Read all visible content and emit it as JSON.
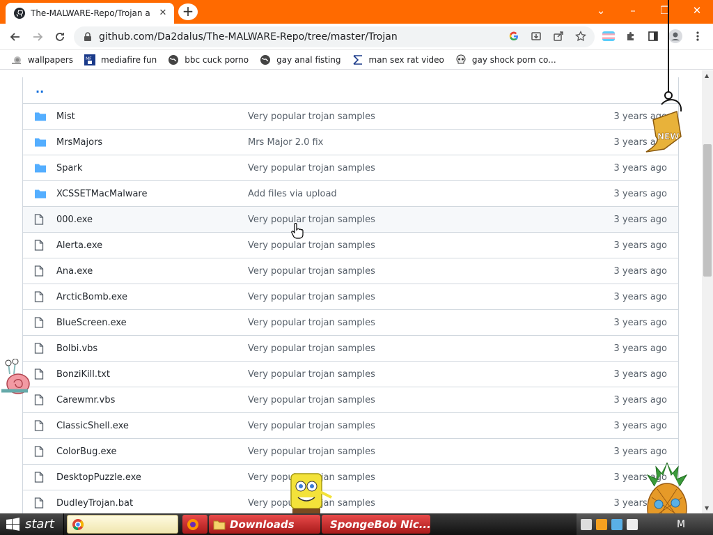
{
  "browser": {
    "tab_title": "The-MALWARE-Repo/Trojan a",
    "new_tab_symbol": "+",
    "url": "github.com/Da2dalus/The-MALWARE-Repo/tree/master/Trojan",
    "accent": "#ff6a00"
  },
  "bookmarks": [
    {
      "label": "wallpapers",
      "icon": "snail-icon"
    },
    {
      "label": "mediafire fun",
      "icon": "mediafire-icon"
    },
    {
      "label": "bbc cuck porno",
      "icon": "globe-icon"
    },
    {
      "label": "gay anal fisting",
      "icon": "globe-icon"
    },
    {
      "label": "man sex rat video",
      "icon": "sigma-icon"
    },
    {
      "label": "gay shock porn co...",
      "icon": "skull-icon"
    }
  ],
  "repo": {
    "parent_dir": "..",
    "files": [
      {
        "name": "Mist",
        "type": "folder",
        "message": "Very popular trojan samples",
        "age": "3 years ago"
      },
      {
        "name": "MrsMajors",
        "type": "folder",
        "message": "Mrs Major 2.0 fix",
        "age": "3 years ago"
      },
      {
        "name": "Spark",
        "type": "folder",
        "message": "Very popular trojan samples",
        "age": "3 years ago"
      },
      {
        "name": "XCSSETMacMalware",
        "type": "folder",
        "message": "Add files via upload",
        "age": "3 years ago"
      },
      {
        "name": "000.exe",
        "type": "file",
        "message": "Very popular trojan samples",
        "age": "3 years ago"
      },
      {
        "name": "Alerta.exe",
        "type": "file",
        "message": "Very popular trojan samples",
        "age": "3 years ago"
      },
      {
        "name": "Ana.exe",
        "type": "file",
        "message": "Very popular trojan samples",
        "age": "3 years ago"
      },
      {
        "name": "ArcticBomb.exe",
        "type": "file",
        "message": "Very popular trojan samples",
        "age": "3 years ago"
      },
      {
        "name": "BlueScreen.exe",
        "type": "file",
        "message": "Very popular trojan samples",
        "age": "3 years ago"
      },
      {
        "name": "Bolbi.vbs",
        "type": "file",
        "message": "Very popular trojan samples",
        "age": "3 years ago"
      },
      {
        "name": "BonziKill.txt",
        "type": "file",
        "message": "Very popular trojan samples",
        "age": "3 years ago"
      },
      {
        "name": "Carewmr.vbs",
        "type": "file",
        "message": "Very popular trojan samples",
        "age": "3 years ago"
      },
      {
        "name": "ClassicShell.exe",
        "type": "file",
        "message": "Very popular trojan samples",
        "age": "3 years ago"
      },
      {
        "name": "ColorBug.exe",
        "type": "file",
        "message": "Very popular trojan samples",
        "age": "3 years ago"
      },
      {
        "name": "DesktopPuzzle.exe",
        "type": "file",
        "message": "Very popular trojan samples",
        "age": "3 years ago"
      },
      {
        "name": "DudleyTrojan.bat",
        "type": "file",
        "message": "Very popular trojan samples",
        "age": "3 years ago"
      }
    ]
  },
  "overlay": {
    "new_badge": "NEW"
  },
  "taskbar": {
    "start_label": "start",
    "tasks": [
      {
        "label": "",
        "icon": "chrome-icon"
      },
      {
        "label": "",
        "icon": "firefox-icon"
      },
      {
        "label": "Downloads",
        "icon": "folder-icon"
      },
      {
        "label": "SpongeBob Nic...",
        "icon": "spongebob-icon"
      }
    ],
    "tray_letter": "M"
  }
}
